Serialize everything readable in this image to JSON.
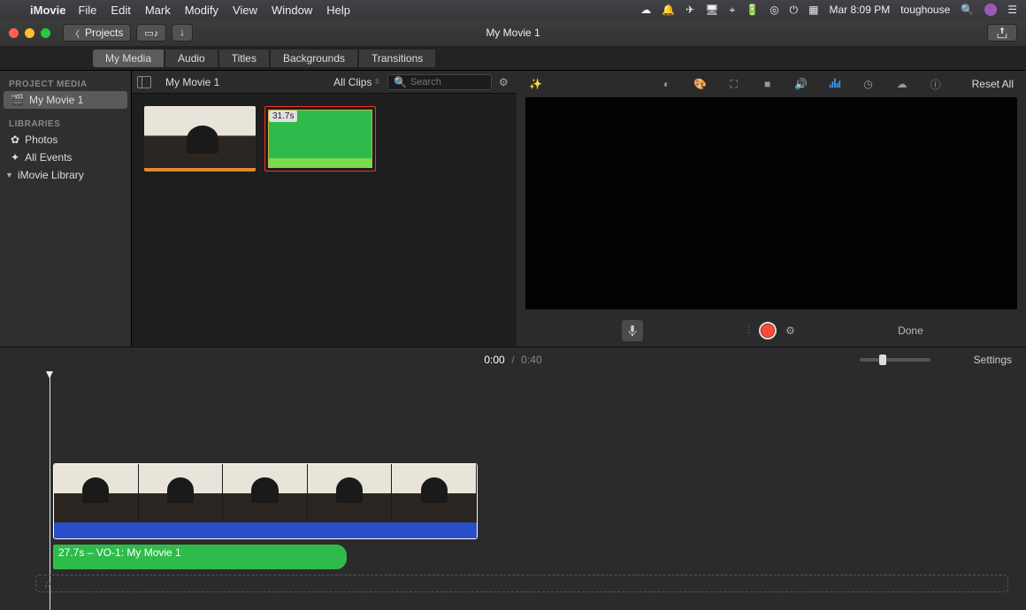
{
  "menubar": {
    "app": "iMovie",
    "items": [
      "File",
      "Edit",
      "Mark",
      "Modify",
      "View",
      "Window",
      "Help"
    ],
    "clock": "Mar 8:09 PM",
    "user": "toughouse"
  },
  "toolbar": {
    "projects": "Projects",
    "title": "My Movie 1"
  },
  "mediatabs": [
    "My Media",
    "Audio",
    "Titles",
    "Backgrounds",
    "Transitions"
  ],
  "mediatabs_active": 0,
  "sidebar": {
    "header1": "PROJECT MEDIA",
    "project": "My Movie 1",
    "header2": "LIBRARIES",
    "photos": "Photos",
    "allevents": "All Events",
    "library": "iMovie Library"
  },
  "browser": {
    "project_name": "My Movie 1",
    "filter": "All Clips",
    "search_placeholder": "Search",
    "audio_badge": "31.7s"
  },
  "preview": {
    "reset": "Reset All",
    "done": "Done"
  },
  "timeline": {
    "current": "0:00",
    "duration": "0:40",
    "settings": "Settings",
    "audio_clip_label": "27.7s – VO-1: My Movie 1"
  }
}
